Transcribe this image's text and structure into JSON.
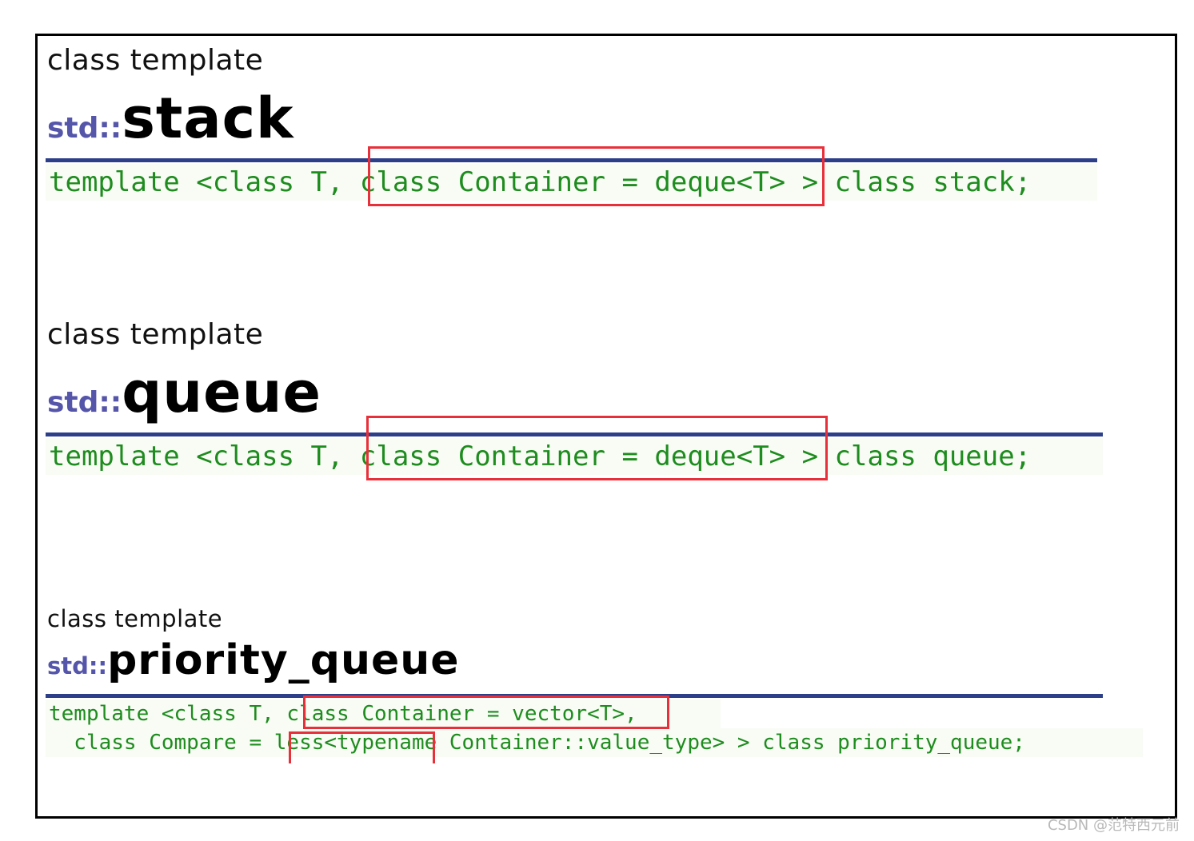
{
  "sections": [
    {
      "kind": "class template",
      "namespace": "std::",
      "name": "stack",
      "code": "template <class T, class Container = deque<T> > class stack;",
      "highlight": "class Container = deque<T>"
    },
    {
      "kind": "class template",
      "namespace": "std::",
      "name": "queue",
      "code": "template <class T, class Container = deque<T> > class queue;",
      "highlight": "class Container = deque<T>"
    },
    {
      "kind": "class template",
      "namespace": "std::",
      "name": "priority_queue",
      "code_line1": "template <class T, class Container = vector<T>,",
      "code_line2": "  class Compare = less<typename Container::value_type> > class priority_queue;",
      "highlight1": "class Container = vector<T>",
      "highlight2": "less<typena"
    }
  ],
  "colors": {
    "namespace": "#5555aa",
    "rule": "#2e3f8a",
    "code_text": "#1e8c1e",
    "highlight_box": "#e8303a"
  },
  "watermark": "CSDN @范特西元前"
}
